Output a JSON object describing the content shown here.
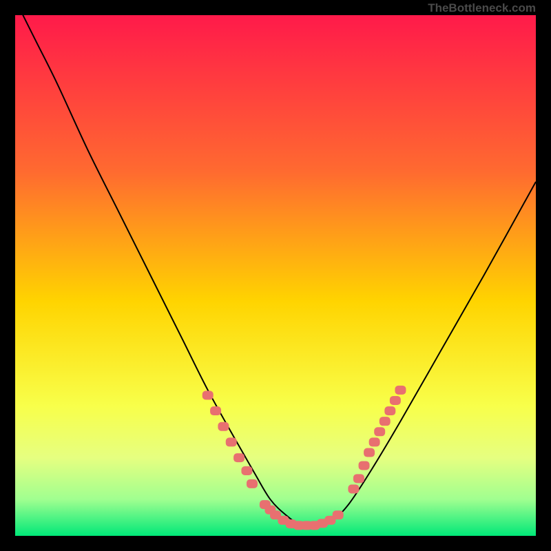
{
  "watermark": "TheBottleneck.com",
  "chart_data": {
    "type": "line",
    "title": "",
    "xlabel": "",
    "ylabel": "",
    "xlim": [
      0,
      100
    ],
    "ylim": [
      0,
      100
    ],
    "gradient_stops": [
      {
        "offset": 0,
        "color": "#ff1a4a"
      },
      {
        "offset": 30,
        "color": "#ff6a30"
      },
      {
        "offset": 55,
        "color": "#ffd400"
      },
      {
        "offset": 75,
        "color": "#f8ff4a"
      },
      {
        "offset": 85,
        "color": "#e6ff80"
      },
      {
        "offset": 93,
        "color": "#a0ff90"
      },
      {
        "offset": 100,
        "color": "#00e878"
      }
    ],
    "series": [
      {
        "name": "bottleneck-curve",
        "x": [
          0,
          4,
          8,
          14,
          20,
          26,
          32,
          37,
          42,
          46,
          49,
          52,
          55,
          58,
          61,
          64,
          68,
          74,
          82,
          90,
          100
        ],
        "y": [
          103,
          95,
          87,
          74,
          62,
          50,
          38,
          28,
          19,
          12,
          7,
          4,
          2,
          2,
          3,
          6,
          12,
          22,
          36,
          50,
          68
        ]
      }
    ],
    "marker_clusters": [
      {
        "name": "left-cluster",
        "points": [
          {
            "x": 37,
            "y": 27
          },
          {
            "x": 38.5,
            "y": 24
          },
          {
            "x": 40,
            "y": 21
          },
          {
            "x": 41.5,
            "y": 18
          },
          {
            "x": 43,
            "y": 15
          },
          {
            "x": 44.5,
            "y": 12.5
          },
          {
            "x": 45.5,
            "y": 10
          }
        ]
      },
      {
        "name": "bottom-cluster",
        "points": [
          {
            "x": 48,
            "y": 6
          },
          {
            "x": 49,
            "y": 5
          },
          {
            "x": 50,
            "y": 4
          },
          {
            "x": 51.5,
            "y": 3
          },
          {
            "x": 53,
            "y": 2.3
          },
          {
            "x": 54.5,
            "y": 2
          },
          {
            "x": 56,
            "y": 2
          },
          {
            "x": 57.5,
            "y": 2
          },
          {
            "x": 59,
            "y": 2.4
          },
          {
            "x": 60.5,
            "y": 3
          },
          {
            "x": 62,
            "y": 4
          }
        ]
      },
      {
        "name": "right-cluster",
        "points": [
          {
            "x": 65,
            "y": 9
          },
          {
            "x": 66,
            "y": 11
          },
          {
            "x": 67,
            "y": 13.5
          },
          {
            "x": 68,
            "y": 16
          },
          {
            "x": 69,
            "y": 18
          },
          {
            "x": 70,
            "y": 20
          },
          {
            "x": 71,
            "y": 22
          },
          {
            "x": 72,
            "y": 24
          },
          {
            "x": 73,
            "y": 26
          },
          {
            "x": 74,
            "y": 28
          }
        ]
      }
    ],
    "marker_color": "#e87070",
    "curve_color": "#000000"
  }
}
